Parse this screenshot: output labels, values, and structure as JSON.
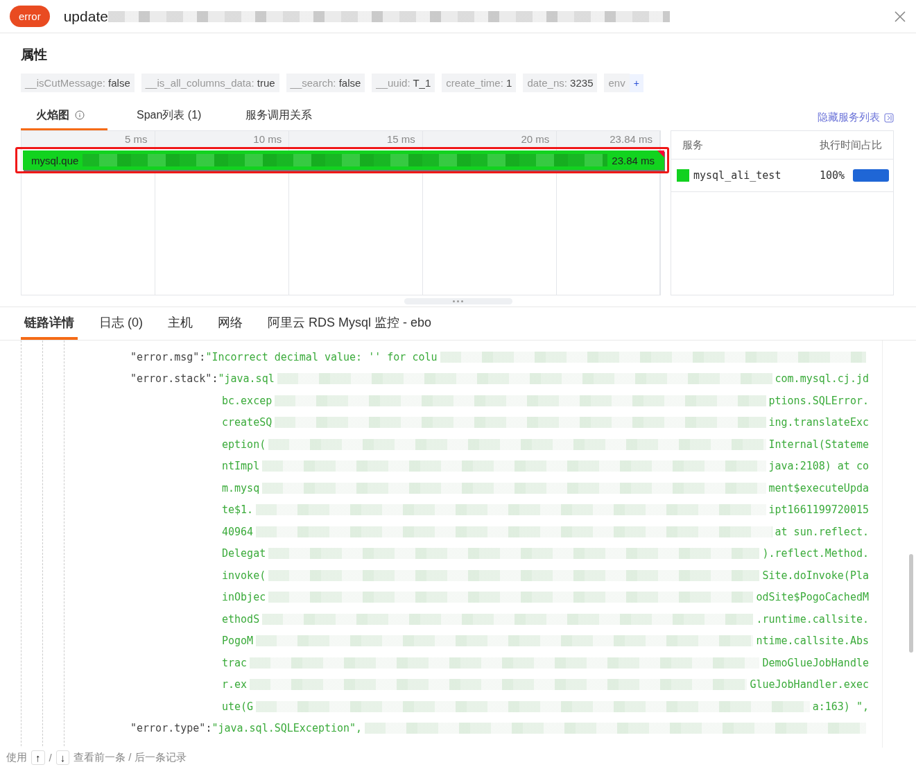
{
  "header": {
    "badge": "error",
    "title": "update"
  },
  "attributes": {
    "title": "属性",
    "more": "+",
    "separator": ":",
    "tags": [
      {
        "key": "__isCutMessage",
        "value": "false"
      },
      {
        "key": "__is_all_columns_data",
        "value": "true"
      },
      {
        "key": "__search",
        "value": "false"
      },
      {
        "key": "__uuid",
        "value": "T_1"
      },
      {
        "key": "create_time",
        "value": "1"
      },
      {
        "key": "date_ns",
        "value": "3235"
      },
      {
        "key": "env"
      }
    ]
  },
  "view_tabs": [
    {
      "label": "火焰图",
      "selected": true,
      "info": true
    },
    {
      "label": "Span列表 (1)",
      "selected": false
    },
    {
      "label": "服务调用关系",
      "selected": false
    }
  ],
  "hide_services": "隐藏服务列表",
  "flame": {
    "ticks": [
      "5 ms",
      "10 ms",
      "15 ms",
      "20 ms",
      "23.84 ms"
    ],
    "span": {
      "label": "mysql.que",
      "duration": "23.84 ms",
      "error": true
    }
  },
  "services": {
    "columns": [
      "服务",
      "执行时间占比"
    ],
    "rows": [
      {
        "name": "mysql_ali_test",
        "color": "#11d11f",
        "percent": "100%",
        "level": 1
      }
    ]
  },
  "detail_tabs": [
    {
      "label": "链路详情",
      "selected": true
    },
    {
      "label": "日志 (0)",
      "selected": false
    },
    {
      "label": "主机",
      "selected": false
    },
    {
      "label": "网络",
      "selected": false
    },
    {
      "label": "阿里云 RDS Mysql 监控 - ebo",
      "selected": false
    }
  ],
  "code_separator": ":",
  "code": [
    {
      "kind": "entry",
      "key": "\"error.msg\"",
      "value": "\"Incorrect decimal value: '' for colu"
    },
    {
      "kind": "entry",
      "key": "\"error.stack\"",
      "value": "\"java.sql",
      "tail": "com.mysql.cj.jd"
    },
    {
      "kind": "cont",
      "text": "bc.excep",
      "tail": "ptions.SQLError."
    },
    {
      "kind": "cont",
      "text": "createSQ",
      "tail": "ing.translateExc"
    },
    {
      "kind": "cont",
      "text": "eption(",
      "tail": "Internal(Stateme"
    },
    {
      "kind": "cont",
      "text": "ntImpl",
      "tail": "java:2108) at co"
    },
    {
      "kind": "cont",
      "text": "m.mysq",
      "tail": "ment$executeUpda"
    },
    {
      "kind": "cont",
      "text": "te$1.",
      "tail": "ipt1661199720015"
    },
    {
      "kind": "cont",
      "text": "40964",
      "tail": "at sun.reflect."
    },
    {
      "kind": "cont",
      "text": "Delegat",
      "tail": ").reflect.Method."
    },
    {
      "kind": "cont",
      "text": "invoke(",
      "tail": "Site.doInvoke(Pla"
    },
    {
      "kind": "cont",
      "text": "inObjec",
      "tail": "odSite$PogoCachedM"
    },
    {
      "kind": "cont",
      "text": "ethodS",
      "tail": ".runtime.callsite."
    },
    {
      "kind": "cont",
      "text": "PogoM",
      "tail": "ntime.callsite.Abs"
    },
    {
      "kind": "cont",
      "text": "trac",
      "tail": "DemoGlueJobHandle"
    },
    {
      "kind": "cont",
      "text": "r.ex",
      "tail": "GlueJobHandler.exec"
    },
    {
      "kind": "cont",
      "text": "ute(G",
      "tail": "a:163) \","
    },
    {
      "kind": "entry",
      "key": "\"error.type\"",
      "value": "\"java.sql.SQLException\","
    }
  ],
  "footer": {
    "prefix": "使用",
    "up": "↑",
    "slash": "/",
    "down": "↓",
    "suffix": "查看前一条 / 后一条记录"
  }
}
